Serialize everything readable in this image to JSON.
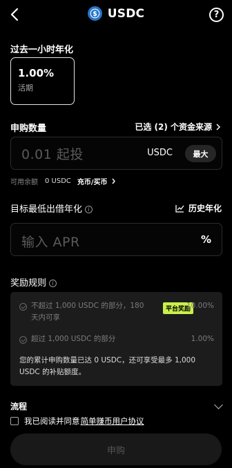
{
  "header": {
    "title": "USDC",
    "coin_icon": "usdc-dollar-icon",
    "help_glyph": "?"
  },
  "past_hour": {
    "label": "过去一小时年化",
    "rate": "1.00%",
    "rate_type": "活期"
  },
  "subscribe": {
    "label": "申购数量",
    "sources_link": "已选 (2) 个资金来源",
    "amount_placeholder": "0.01 起投",
    "unit": "USDC",
    "max_label": "最大",
    "available_label": "可用余额",
    "available_value": "0 USDC",
    "deposit_link": "充币/买币"
  },
  "target_apr": {
    "label": "目标最低出借年化",
    "history_label": "历史年化",
    "placeholder": "输入 APR",
    "unit": "%"
  },
  "reward": {
    "label": "奖励规则",
    "tiers": [
      {
        "text_line1": "不超过 1,000 USDC 的部分，180",
        "text_line2": "天内可享",
        "badge": "平台奖励",
        "pct": "10.00%"
      },
      {
        "text_line1": "超过 1,000 USDC 的部分",
        "pct": "1.00%"
      }
    ],
    "note_line1": "您的累计申购数量已达 0 USDC，还可享受最多 1,000",
    "note_line2": "USDC 的补贴额度。"
  },
  "process_label": "流程",
  "agreement": {
    "prefix": "我已阅读并同意",
    "link": "简单赚币用户协议"
  },
  "submit_label": "申购",
  "colors": {
    "background": "#000000",
    "badge": "#c9f04a",
    "usdc_blue": "#2775ca"
  }
}
